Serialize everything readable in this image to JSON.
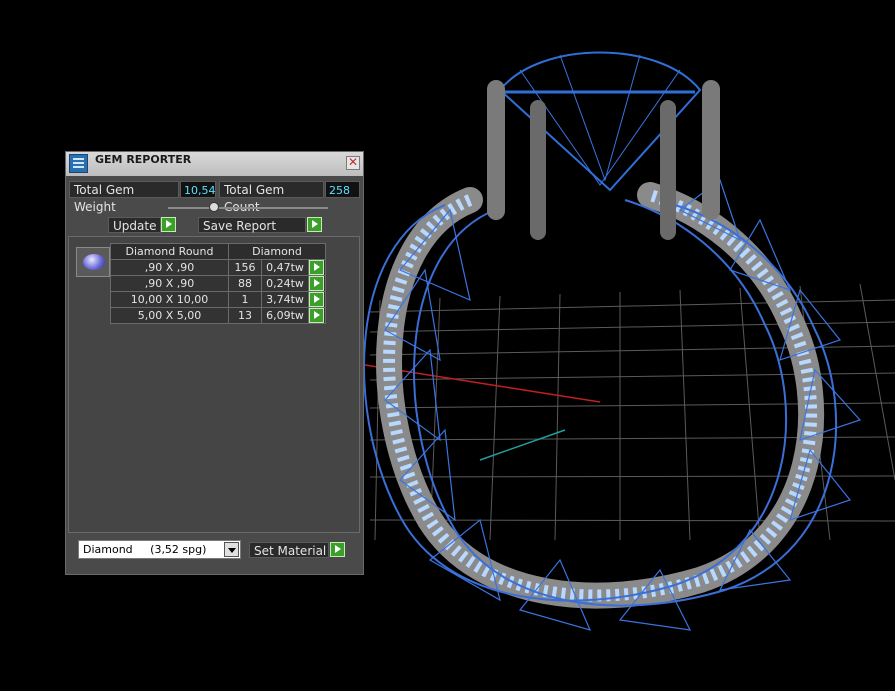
{
  "window": {
    "title": "GEM REPORTER",
    "close_glyph": "✕"
  },
  "stats": {
    "total_weight_label": "Total Gem Weight",
    "total_weight_value": "10,54",
    "total_count_label": "Total Gem Count",
    "total_count_value": "258"
  },
  "actions": {
    "update_label": "Update",
    "save_report_label": "Save Report"
  },
  "table": {
    "headers": [
      "Diamond Round",
      "Diamond"
    ],
    "rows": [
      {
        "size": ",90 X ,90",
        "count": "156",
        "weight": "0,47tw"
      },
      {
        "size": ",90 X ,90",
        "count": "88",
        "weight": "0,24tw"
      },
      {
        "size": "10,00 X 10,00",
        "count": "1",
        "weight": "3,74tw"
      },
      {
        "size": "5,00 X 5,00",
        "count": "13",
        "weight": "6,09tw"
      }
    ]
  },
  "material": {
    "selected": "Diamond     (3,52 spg)",
    "set_label": "Set Material"
  },
  "icons": {
    "app": "gem-reporter-icon",
    "close": "close-icon",
    "play": "play-arrow-icon",
    "dropdown": "chevron-down-icon"
  },
  "colors": {
    "accent_green": "#3aa02a",
    "value_cyan": "#5ee0ff",
    "gem_blue": "#2f6fd8",
    "panel_gray": "#4a4a4a"
  }
}
